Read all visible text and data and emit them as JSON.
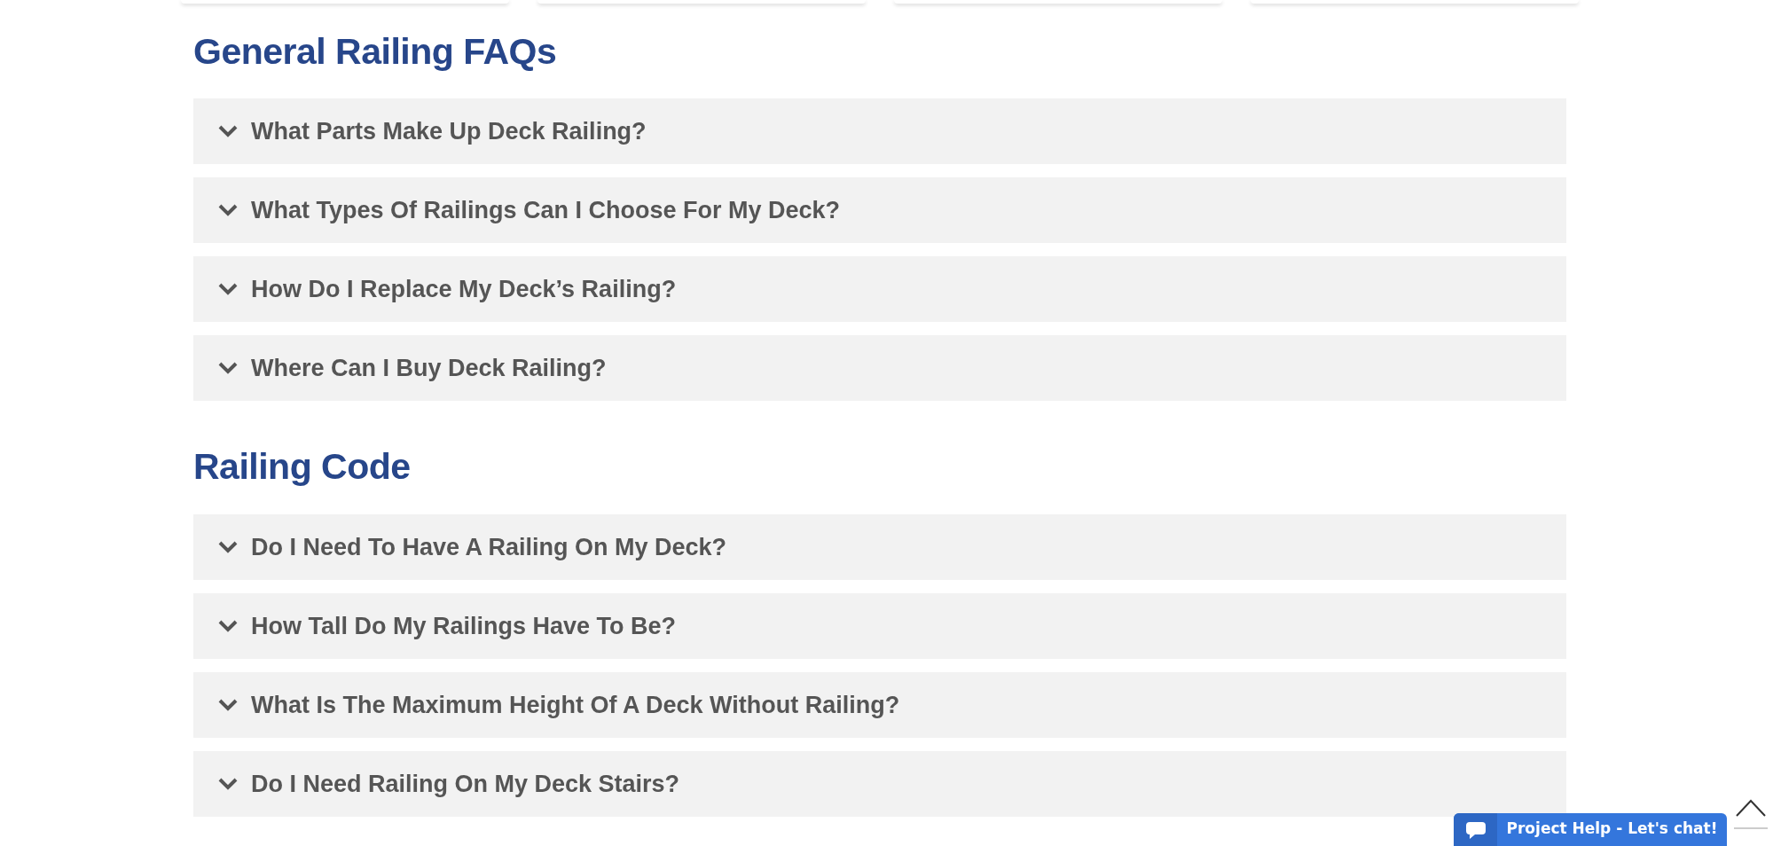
{
  "sections": [
    {
      "title": "General Railing FAQs",
      "questions": [
        "What Parts Make Up Deck Railing?",
        "What Types Of Railings Can I Choose For My Deck?",
        "How Do I Replace My Deck’s Railing?",
        "Where Can I Buy Deck Railing?"
      ]
    },
    {
      "title": "Railing Code",
      "questions": [
        "Do I Need To Have A Railing On My Deck?",
        "How Tall Do My Railings Have To Be?",
        "What Is The Maximum Height Of A Deck Without Railing?",
        "Do I Need Railing On My Deck Stairs?"
      ]
    }
  ],
  "chat_button": {
    "label": "Project Help - Let's chat!"
  }
}
